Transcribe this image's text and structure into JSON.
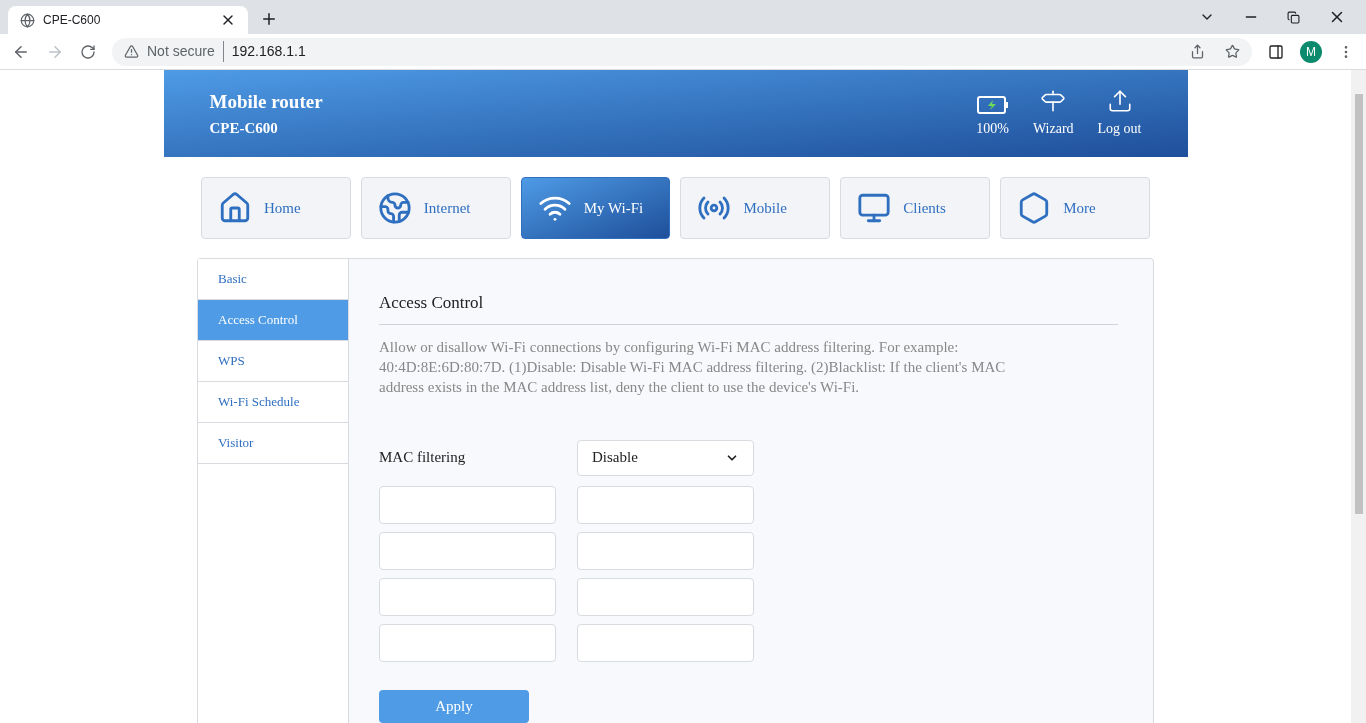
{
  "browser": {
    "tab_title": "CPE-C600",
    "security": "Not secure",
    "url": "192.168.1.1",
    "profile_initial": "M"
  },
  "header": {
    "title": "Mobile router",
    "model": "CPE-C600",
    "battery": "100%",
    "actions": [
      {
        "kind": "wizard",
        "label": "Wizard"
      },
      {
        "kind": "logout",
        "label": "Log out"
      }
    ]
  },
  "nav": [
    {
      "kind": "home",
      "label": "Home",
      "selected": false
    },
    {
      "kind": "internet",
      "label": "Internet",
      "selected": false
    },
    {
      "kind": "wifi",
      "label": "My Wi-Fi",
      "selected": true
    },
    {
      "kind": "mobile",
      "label": "Mobile",
      "selected": false
    },
    {
      "kind": "clients",
      "label": "Clients",
      "selected": false
    },
    {
      "kind": "more",
      "label": "More",
      "selected": false
    }
  ],
  "sidebar": [
    {
      "label": "Basic",
      "selected": false
    },
    {
      "label": "Access Control",
      "selected": true
    },
    {
      "label": "WPS",
      "selected": false
    },
    {
      "label": "Wi-Fi Schedule",
      "selected": false
    },
    {
      "label": "Visitor",
      "selected": false
    }
  ],
  "content": {
    "title": "Access Control",
    "description": "Allow or disallow Wi-Fi connections by configuring Wi-Fi MAC address filtering. For example: 40:4D:8E:6D:80:7D. (1)Disable: Disable Wi-Fi MAC address filtering. (2)Blacklist: If the client's MAC address exists in the MAC address list, deny the client to use the device's Wi-Fi.",
    "mac_filtering_label": "MAC filtering",
    "mac_filtering_value": "Disable",
    "apply": "Apply"
  }
}
